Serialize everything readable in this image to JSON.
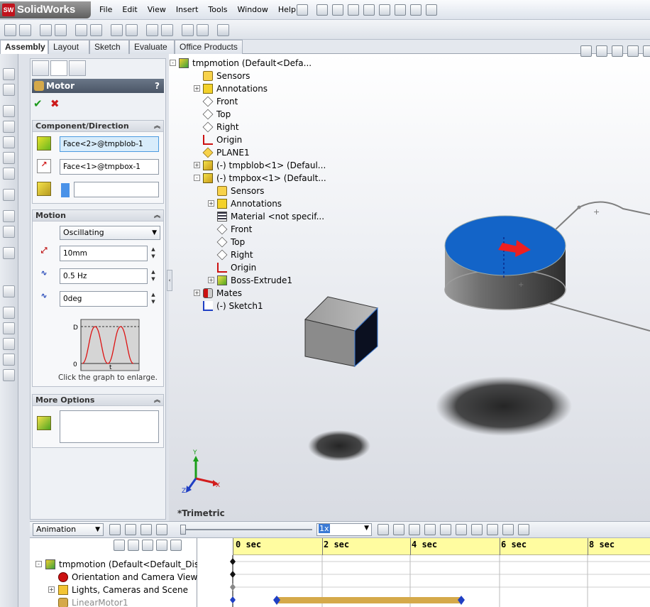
{
  "app": {
    "name": "SolidWorks",
    "logo_mark": "SW"
  },
  "menu": [
    "File",
    "Edit",
    "View",
    "Insert",
    "Tools",
    "Window",
    "Help"
  ],
  "tabs": [
    "Assembly",
    "Layout",
    "Sketch",
    "Evaluate",
    "Office Products"
  ],
  "active_tab": "Assembly",
  "property_manager": {
    "title": "Motor",
    "help": "?",
    "ok_icon": "check-icon",
    "cancel_icon": "x-icon",
    "component_direction": {
      "header": "Component/Direction",
      "face1": "Face<2>@tmpblob-1",
      "face2": "Face<1>@tmpbox-1",
      "relative": ""
    },
    "motion": {
      "header": "Motion",
      "type": "Oscillating",
      "displacement": "10mm",
      "frequency": "0.5 Hz",
      "phase": "0deg",
      "graph_y_label": "D",
      "graph_y_zero": "0",
      "graph_x_label": "t",
      "hint": "Click the graph to enlarge."
    },
    "more_options": {
      "header": "More Options",
      "value": ""
    }
  },
  "feature_tree": [
    {
      "label": "tmpmotion  (Default<Defa...",
      "icon": "assembly-icon",
      "depth": 0,
      "expander": "-"
    },
    {
      "label": "Sensors",
      "icon": "sensor-icon",
      "depth": 1
    },
    {
      "label": "Annotations",
      "icon": "annotation-icon",
      "depth": 1,
      "expander": "+"
    },
    {
      "label": "Front",
      "icon": "plane-icon",
      "depth": 1
    },
    {
      "label": "Top",
      "icon": "plane-icon",
      "depth": 1
    },
    {
      "label": "Right",
      "icon": "plane-icon",
      "depth": 1
    },
    {
      "label": "Origin",
      "icon": "origin-icon",
      "depth": 1
    },
    {
      "label": "PLANE1",
      "icon": "plane-yellow-icon",
      "depth": 1
    },
    {
      "label": "(-) tmpblob<1> (Defaul...",
      "icon": "part-icon",
      "depth": 1,
      "expander": "+"
    },
    {
      "label": "(-) tmpbox<1> (Default...",
      "icon": "part-icon",
      "depth": 1,
      "expander": "-"
    },
    {
      "label": "Sensors",
      "icon": "sensor-icon",
      "depth": 2
    },
    {
      "label": "Annotations",
      "icon": "annotation-icon",
      "depth": 2,
      "expander": "+"
    },
    {
      "label": "Material <not specif...",
      "icon": "material-icon",
      "depth": 2
    },
    {
      "label": "Front",
      "icon": "plane-icon",
      "depth": 2
    },
    {
      "label": "Top",
      "icon": "plane-icon",
      "depth": 2
    },
    {
      "label": "Right",
      "icon": "plane-icon",
      "depth": 2
    },
    {
      "label": "Origin",
      "icon": "origin-icon",
      "depth": 2
    },
    {
      "label": "Boss-Extrude1",
      "icon": "extrude-icon",
      "depth": 2,
      "expander": "+"
    },
    {
      "label": "Mates",
      "icon": "mates-icon",
      "depth": 1,
      "expander": "+"
    },
    {
      "label": "(-) Sketch1",
      "icon": "sketch-icon",
      "depth": 1
    }
  ],
  "graphics": {
    "view_name": "*Trimetric",
    "triad": {
      "x": "X",
      "y": "Y",
      "z": "Z"
    }
  },
  "motion_manager": {
    "study_type": "Animation",
    "playback_speed": "1x",
    "tree": [
      {
        "label": "tmpmotion  (Default<Default_Displ",
        "icon": "assembly-icon",
        "expander": "-"
      },
      {
        "label": "Orientation and Camera Views",
        "icon": "camera-off-icon"
      },
      {
        "label": "Lights, Cameras and Scene",
        "icon": "folder-lights-icon",
        "expander": "+"
      },
      {
        "label": "LinearMotor1",
        "icon": "motor-icon"
      }
    ],
    "time_labels": [
      "0 sec",
      "2 sec",
      "4 sec",
      "6 sec",
      "8 sec"
    ]
  },
  "colors": {
    "accent_blue": "#1565c9",
    "timeline_yellow": "#fffca0",
    "motor_bar": "#d5a94a",
    "pm_title_bg": "#56627a"
  }
}
